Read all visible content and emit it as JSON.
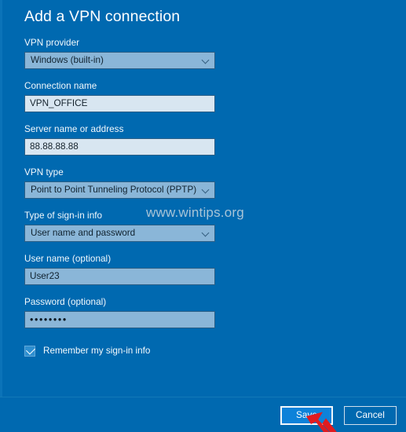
{
  "dialog": {
    "title": "Add a VPN connection"
  },
  "fields": {
    "vpn_provider": {
      "label": "VPN provider",
      "value": "Windows (built-in)",
      "control": "dropdown"
    },
    "connection_name": {
      "label": "Connection name",
      "value": "VPN_OFFICE",
      "control": "textbox"
    },
    "server_address": {
      "label": "Server name or address",
      "value": "88.88.88.88",
      "control": "textbox"
    },
    "vpn_type": {
      "label": "VPN type",
      "value": "Point to Point Tunneling Protocol (PPTP)",
      "control": "dropdown"
    },
    "sign_in_type": {
      "label": "Type of sign-in info",
      "value": "User name and password",
      "control": "dropdown"
    },
    "user_name": {
      "label": "User name (optional)",
      "value": "User23",
      "control": "textbox"
    },
    "password": {
      "label": "Password (optional)",
      "value": "••••••••",
      "control": "textbox"
    }
  },
  "checkbox": {
    "label": "Remember my sign-in info",
    "checked": true
  },
  "watermark": {
    "text": "www.wintips.org"
  },
  "buttons": {
    "save_label": "Save",
    "cancel_label": "Cancel"
  },
  "icons": {
    "chevron_down": "chevron-down-icon",
    "check": "check-icon",
    "pointer_arrow": "pointer-arrow-icon"
  },
  "colors": {
    "background": "#0069b0",
    "textbox_light": "#d8e6f1",
    "textbox_tinted": "#8ab6d8",
    "dropdown": "#8ab6d8",
    "field_border": "#2b5f86",
    "primary_button": "#0d82d9",
    "checkbox_fill": "#2e8fd0",
    "pointer_arrow": "#e01b20"
  }
}
